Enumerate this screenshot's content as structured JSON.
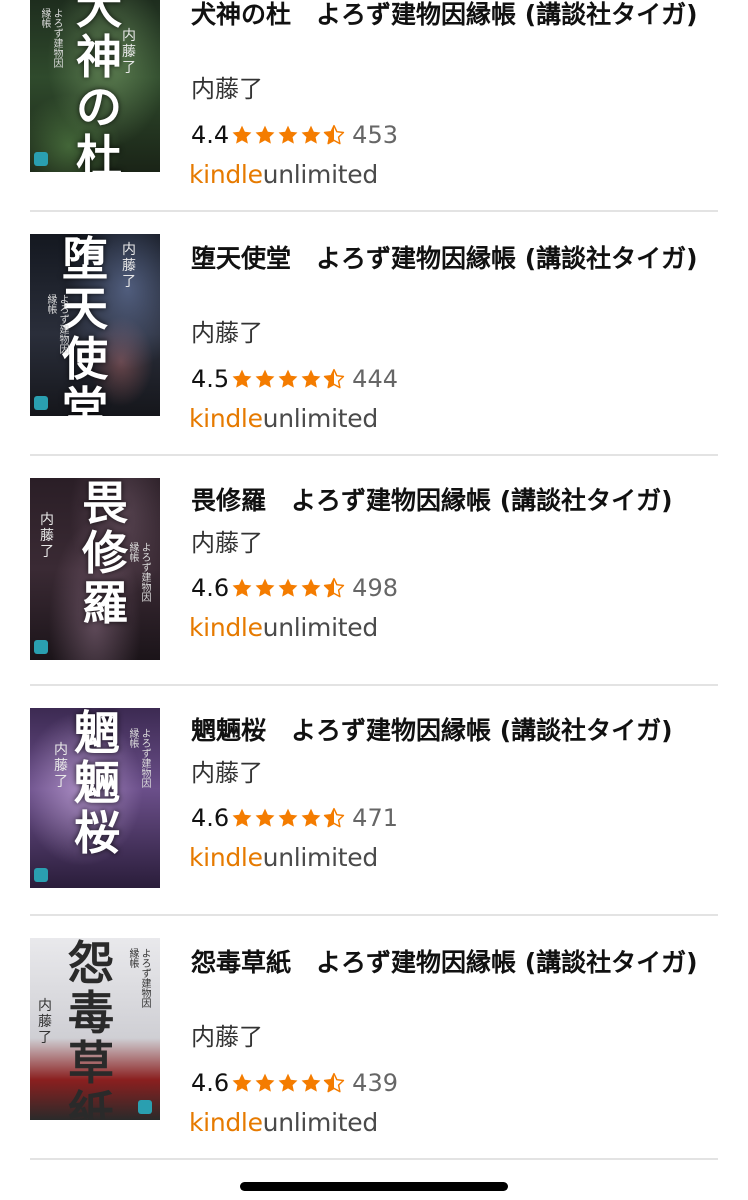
{
  "products": [
    {
      "cover": {
        "title": "犬神の杜",
        "author": "内藤了",
        "subtitle": "よろず建物因縁帳"
      },
      "title": "犬神の杜　よろず建物因縁帳 (講談社タイガ)",
      "author": "内藤了",
      "rating": "4.4",
      "stars": 4.5,
      "review_count": "453",
      "badge": {
        "brand": "kindle",
        "plan": "unlimited"
      }
    },
    {
      "cover": {
        "title": "堕天使堂",
        "author": "内藤了",
        "subtitle": "よろず建物因縁帳"
      },
      "title": "堕天使堂　よろず建物因縁帳 (講談社タイガ)",
      "author": "内藤了",
      "rating": "4.5",
      "stars": 4.5,
      "review_count": "444",
      "badge": {
        "brand": "kindle",
        "plan": "unlimited"
      }
    },
    {
      "cover": {
        "title": "畏修羅",
        "author": "内藤了",
        "subtitle": "よろず建物因縁帳"
      },
      "title": "畏修羅　よろず建物因縁帳 (講談社タイガ)",
      "author": "内藤了",
      "rating": "4.6",
      "stars": 4.5,
      "review_count": "498",
      "badge": {
        "brand": "kindle",
        "plan": "unlimited"
      }
    },
    {
      "cover": {
        "title": "魍魎桜",
        "author": "内藤了",
        "subtitle": "よろず建物因縁帳"
      },
      "title": "魍魎桜　よろず建物因縁帳 (講談社タイガ)",
      "author": "内藤了",
      "rating": "4.6",
      "stars": 4.5,
      "review_count": "471",
      "badge": {
        "brand": "kindle",
        "plan": "unlimited"
      }
    },
    {
      "cover": {
        "title": "怨毒草紙",
        "author": "内藤了",
        "subtitle": "よろず建物因縁帳"
      },
      "title": "怨毒草紙　よろず建物因縁帳 (講談社タイガ)",
      "author": "内藤了",
      "rating": "4.6",
      "stars": 4.5,
      "review_count": "439",
      "badge": {
        "brand": "kindle",
        "plan": "unlimited"
      }
    }
  ],
  "colors": {
    "star": "#f47c00",
    "kindle_orange": "#e67a00",
    "divider": "#e3e3e3"
  },
  "icons": {
    "star_full": "star-full-icon",
    "star_half": "star-half-icon"
  }
}
